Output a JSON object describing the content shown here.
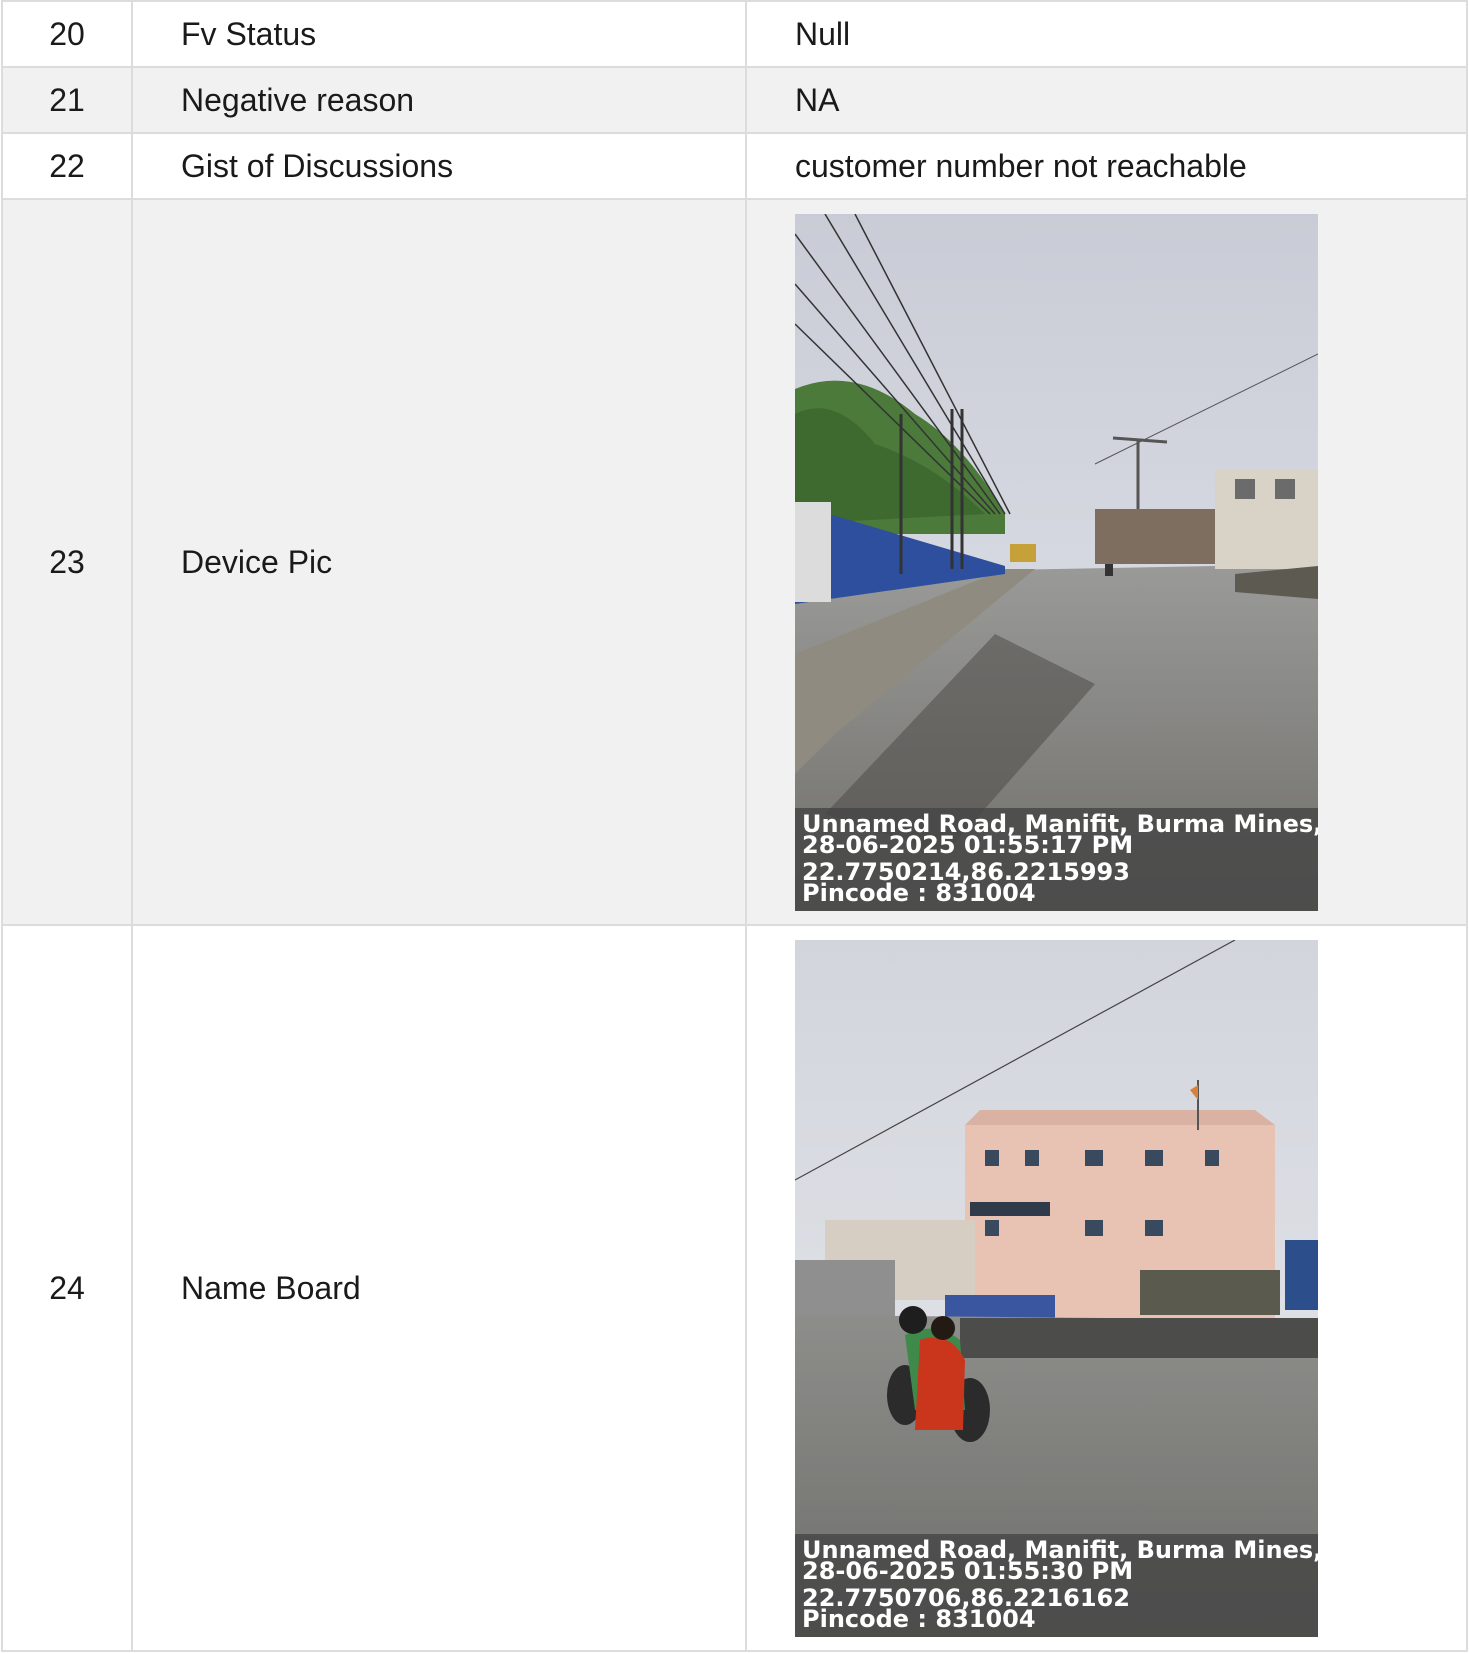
{
  "rows": [
    {
      "num": "20",
      "label": "Fv Status",
      "value": "Null"
    },
    {
      "num": "21",
      "label": "Negative reason",
      "value": "NA"
    },
    {
      "num": "22",
      "label": "Gist of Discussions",
      "value": "customer number not reachable"
    },
    {
      "num": "23",
      "label": "Device Pic",
      "photo": {
        "address": "Unnamed Road, Manifit, Burma Mines, Jams",
        "datetime": "28-06-2025 01:55:17 PM",
        "coords": "22.7750214,86.2215993",
        "pincode": "Pincode : 831004"
      }
    },
    {
      "num": "24",
      "label": "Name Board",
      "photo": {
        "address": "Unnamed Road, Manifit, Burma Mines, Jams",
        "datetime": "28-06-2025 01:55:30 PM",
        "coords": "22.7750706,86.2216162",
        "pincode": "Pincode : 831004"
      }
    }
  ]
}
